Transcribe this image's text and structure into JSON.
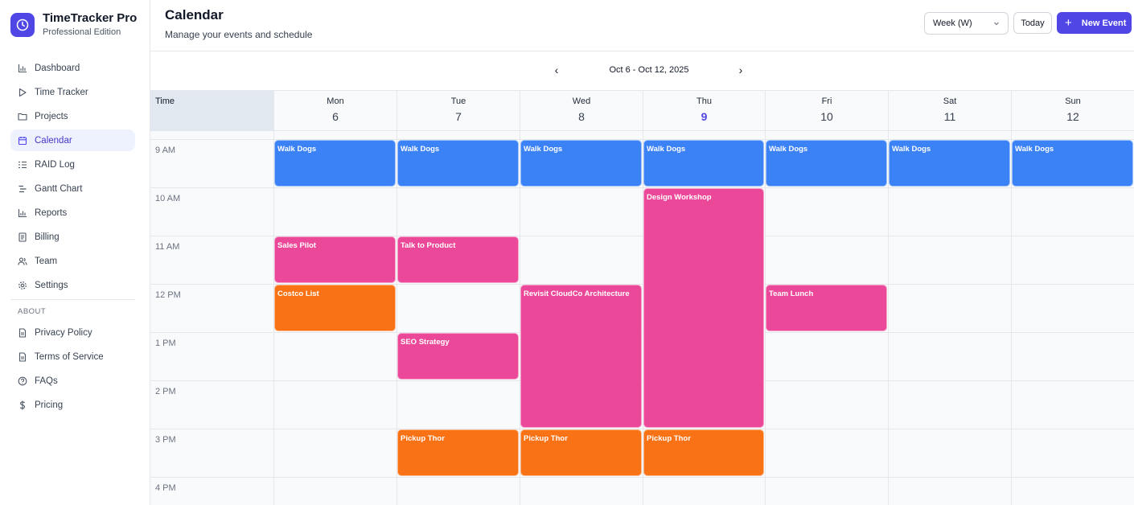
{
  "brand": {
    "title": "TimeTracker Pro",
    "subtitle": "Professional Edition"
  },
  "nav": {
    "items": [
      {
        "label": "Dashboard",
        "icon": "bar-chart-icon"
      },
      {
        "label": "Time Tracker",
        "icon": "play-icon"
      },
      {
        "label": "Projects",
        "icon": "folder-icon"
      },
      {
        "label": "Calendar",
        "icon": "calendar-icon",
        "active": true
      },
      {
        "label": "RAID Log",
        "icon": "list-check-icon"
      },
      {
        "label": "Gantt Chart",
        "icon": "gantt-icon"
      },
      {
        "label": "Reports",
        "icon": "bar-chart-icon"
      },
      {
        "label": "Billing",
        "icon": "receipt-icon"
      },
      {
        "label": "Team",
        "icon": "users-icon"
      },
      {
        "label": "Settings",
        "icon": "gear-icon"
      }
    ],
    "about_label": "ABOUT",
    "about_items": [
      {
        "label": "Privacy Policy",
        "icon": "document-icon"
      },
      {
        "label": "Terms of Service",
        "icon": "document-icon"
      },
      {
        "label": "FAQs",
        "icon": "help-circle-icon"
      },
      {
        "label": "Pricing",
        "icon": "dollar-icon"
      }
    ]
  },
  "header": {
    "title": "Calendar",
    "subtitle": "Manage your events and schedule",
    "view_select": "Week (W)",
    "today_label": "Today",
    "new_event_label": "New Event"
  },
  "date_nav": {
    "prev": "‹",
    "range": "Oct 6 - Oct 12, 2025",
    "next": "›"
  },
  "calendar": {
    "time_header": "Time",
    "days": [
      {
        "name": "Mon",
        "num": "6"
      },
      {
        "name": "Tue",
        "num": "7"
      },
      {
        "name": "Wed",
        "num": "8"
      },
      {
        "name": "Thu",
        "num": "9",
        "today": true
      },
      {
        "name": "Fri",
        "num": "10"
      },
      {
        "name": "Sat",
        "num": "11"
      },
      {
        "name": "Sun",
        "num": "12"
      }
    ],
    "hours": [
      "9 AM",
      "10 AM",
      "11 AM",
      "12 PM",
      "1 PM",
      "2 PM",
      "3 PM",
      "4 PM"
    ],
    "colors": {
      "blue": "#3b82f6",
      "pink": "#ec4899",
      "orange": "#f97316",
      "accent": "#4f46e5"
    },
    "events": [
      {
        "title": "Walk Dogs",
        "day": 0,
        "start": 9,
        "end": 10,
        "color": "blue"
      },
      {
        "title": "Walk Dogs",
        "day": 1,
        "start": 9,
        "end": 10,
        "color": "blue"
      },
      {
        "title": "Walk Dogs",
        "day": 2,
        "start": 9,
        "end": 10,
        "color": "blue"
      },
      {
        "title": "Walk Dogs",
        "day": 3,
        "start": 9,
        "end": 10,
        "color": "blue"
      },
      {
        "title": "Walk Dogs",
        "day": 4,
        "start": 9,
        "end": 10,
        "color": "blue"
      },
      {
        "title": "Walk Dogs",
        "day": 5,
        "start": 9,
        "end": 10,
        "color": "blue"
      },
      {
        "title": "Walk Dogs",
        "day": 6,
        "start": 9,
        "end": 10,
        "color": "blue"
      },
      {
        "title": "Design Workshop",
        "day": 3,
        "start": 10,
        "end": 15,
        "color": "pink"
      },
      {
        "title": "Sales Pilot",
        "day": 0,
        "start": 11,
        "end": 12,
        "color": "pink"
      },
      {
        "title": "Talk to Product",
        "day": 1,
        "start": 11,
        "end": 12,
        "color": "pink"
      },
      {
        "title": "Costco List",
        "day": 0,
        "start": 12,
        "end": 13,
        "color": "orange"
      },
      {
        "title": "Revisit CloudCo Architecture",
        "day": 2,
        "start": 12,
        "end": 15,
        "color": "pink"
      },
      {
        "title": "Team Lunch",
        "day": 4,
        "start": 12,
        "end": 13,
        "color": "pink"
      },
      {
        "title": "SEO Strategy",
        "day": 1,
        "start": 13,
        "end": 14,
        "color": "pink"
      },
      {
        "title": "Pickup Thor",
        "day": 1,
        "start": 15,
        "end": 16,
        "color": "orange"
      },
      {
        "title": "Pickup Thor",
        "day": 2,
        "start": 15,
        "end": 16,
        "color": "orange"
      },
      {
        "title": "Pickup Thor",
        "day": 3,
        "start": 15,
        "end": 16,
        "color": "orange"
      }
    ]
  }
}
